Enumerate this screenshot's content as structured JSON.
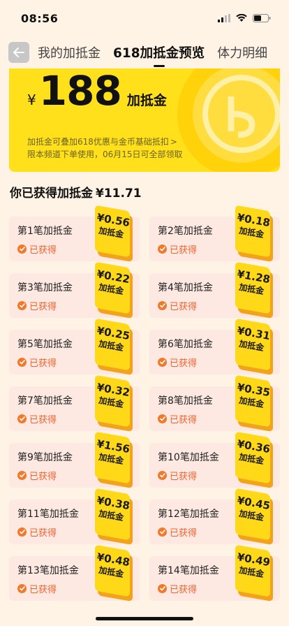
{
  "status_bar": {
    "time": "08:56"
  },
  "header": {
    "tabs": [
      {
        "label": "我的加抵金",
        "active": false
      },
      {
        "label": "618加抵金预览",
        "active": true
      },
      {
        "label": "体力明细",
        "active": false
      }
    ]
  },
  "balance": {
    "currency": "¥",
    "amount": "188",
    "unit": "加抵金",
    "note_line1": "加抵金可叠加618优惠与金币基础抵扣",
    "note_arrow": ">",
    "note_line2": "限本频道下单使用，06月15日可全部领取"
  },
  "earned": {
    "label": "你已获得加抵金",
    "value": "¥11.71"
  },
  "coupon_unit": "加抵金",
  "status_label": "已获得",
  "items": [
    {
      "title": "第1笔加抵金",
      "amount": "¥0.56"
    },
    {
      "title": "第2笔加抵金",
      "amount": "¥0.18"
    },
    {
      "title": "第3笔加抵金",
      "amount": "¥0.22"
    },
    {
      "title": "第4笔加抵金",
      "amount": "¥1.28"
    },
    {
      "title": "第5笔加抵金",
      "amount": "¥0.25"
    },
    {
      "title": "第6笔加抵金",
      "amount": "¥0.31"
    },
    {
      "title": "第7笔加抵金",
      "amount": "¥0.32"
    },
    {
      "title": "第8笔加抵金",
      "amount": "¥0.35"
    },
    {
      "title": "第9笔加抵金",
      "amount": "¥1.56"
    },
    {
      "title": "第10笔加抵金",
      "amount": "¥0.36"
    },
    {
      "title": "第11笔加抵金",
      "amount": "¥0.38"
    },
    {
      "title": "第12笔加抵金",
      "amount": "¥0.45"
    },
    {
      "title": "第13笔加抵金",
      "amount": "¥0.48"
    },
    {
      "title": "第14笔加抵金",
      "amount": "¥0.49"
    }
  ],
  "colors": {
    "accent_yellow": "#ffe01b",
    "status_orange": "#f06432",
    "card_bg": "#fde9e2"
  }
}
